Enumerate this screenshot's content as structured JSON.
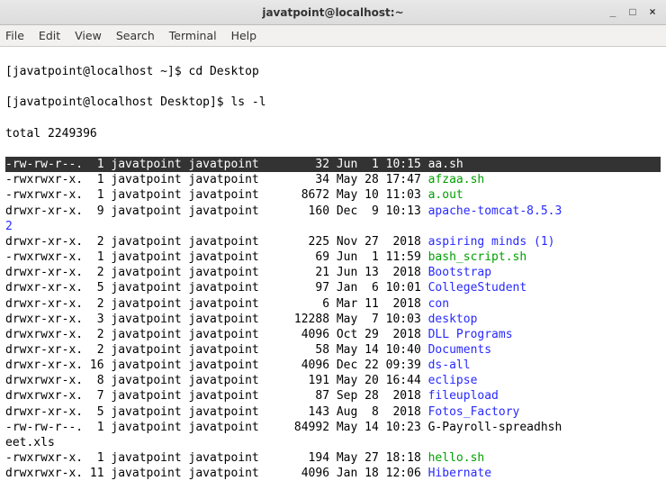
{
  "window": {
    "title": "javatpoint@localhost:~",
    "controls": {
      "min": "_",
      "max": "□",
      "close": "×"
    }
  },
  "menu": {
    "file": "File",
    "edit": "Edit",
    "view": "View",
    "search": "Search",
    "terminal": "Terminal",
    "help": "Help"
  },
  "prompt1": {
    "text": "[javatpoint@localhost ~]$ ",
    "cmd": "cd Desktop"
  },
  "prompt2": {
    "text": "[javatpoint@localhost Desktop]$ ",
    "cmd": "ls -l"
  },
  "total_line": "total 2249396",
  "rows": [
    {
      "perm": "-rw-rw-r--.",
      "links": " 1",
      "owner": "javatpoint",
      "group": "javatpoint",
      "size": "   32",
      "date": "Jun  1 10:15",
      "name": "aa.sh",
      "color": "hl",
      "wrap": ""
    },
    {
      "perm": "-rwxrwxr-x.",
      "links": " 1",
      "owner": "javatpoint",
      "group": "javatpoint",
      "size": "   34",
      "date": "May 28 17:47",
      "name": "afzaa.sh",
      "color": "green",
      "wrap": ""
    },
    {
      "perm": "-rwxrwxr-x.",
      "links": " 1",
      "owner": "javatpoint",
      "group": "javatpoint",
      "size": " 8672",
      "date": "May 10 11:03",
      "name": "a.out",
      "color": "green",
      "wrap": ""
    },
    {
      "perm": "drwxr-xr-x.",
      "links": " 9",
      "owner": "javatpoint",
      "group": "javatpoint",
      "size": "  160",
      "date": "Dec  9 10:13",
      "name": "apache-tomcat-8.5.3",
      "color": "blue",
      "wrap": "2"
    },
    {
      "perm": "drwxr-xr-x.",
      "links": " 2",
      "owner": "javatpoint",
      "group": "javatpoint",
      "size": "  225",
      "date": "Nov 27  2018",
      "name": "aspiring minds (1)",
      "color": "blue",
      "wrap": ""
    },
    {
      "perm": "-rwxrwxr-x.",
      "links": " 1",
      "owner": "javatpoint",
      "group": "javatpoint",
      "size": "   69",
      "date": "Jun  1 11:59",
      "name": "bash_script.sh",
      "color": "green",
      "wrap": ""
    },
    {
      "perm": "drwxr-xr-x.",
      "links": " 2",
      "owner": "javatpoint",
      "group": "javatpoint",
      "size": "   21",
      "date": "Jun 13  2018",
      "name": "Bootstrap",
      "color": "blue",
      "wrap": ""
    },
    {
      "perm": "drwxr-xr-x.",
      "links": " 5",
      "owner": "javatpoint",
      "group": "javatpoint",
      "size": "   97",
      "date": "Jan  6 10:01",
      "name": "CollegeStudent",
      "color": "blue",
      "wrap": ""
    },
    {
      "perm": "drwxr-xr-x.",
      "links": " 2",
      "owner": "javatpoint",
      "group": "javatpoint",
      "size": "    6",
      "date": "Mar 11  2018",
      "name": "con",
      "color": "blue",
      "wrap": ""
    },
    {
      "perm": "drwxr-xr-x.",
      "links": " 3",
      "owner": "javatpoint",
      "group": "javatpoint",
      "size": "12288",
      "date": "May  7 10:03",
      "name": "desktop",
      "color": "blue",
      "wrap": ""
    },
    {
      "perm": "drwxrwxr-x.",
      "links": " 2",
      "owner": "javatpoint",
      "group": "javatpoint",
      "size": " 4096",
      "date": "Oct 29  2018",
      "name": "DLL Programs",
      "color": "blue",
      "wrap": ""
    },
    {
      "perm": "drwxr-xr-x.",
      "links": " 2",
      "owner": "javatpoint",
      "group": "javatpoint",
      "size": "   58",
      "date": "May 14 10:40",
      "name": "Documents",
      "color": "blue",
      "wrap": ""
    },
    {
      "perm": "drwxr-xr-x.",
      "links": "16",
      "owner": "javatpoint",
      "group": "javatpoint",
      "size": " 4096",
      "date": "Dec 22 09:39",
      "name": "ds-all",
      "color": "blue",
      "wrap": ""
    },
    {
      "perm": "drwxrwxr-x.",
      "links": " 8",
      "owner": "javatpoint",
      "group": "javatpoint",
      "size": "  191",
      "date": "May 20 16:44",
      "name": "eclipse",
      "color": "blue",
      "wrap": ""
    },
    {
      "perm": "drwxrwxr-x.",
      "links": " 7",
      "owner": "javatpoint",
      "group": "javatpoint",
      "size": "   87",
      "date": "Sep 28  2018",
      "name": "fileupload",
      "color": "blue",
      "wrap": ""
    },
    {
      "perm": "drwxr-xr-x.",
      "links": " 5",
      "owner": "javatpoint",
      "group": "javatpoint",
      "size": "  143",
      "date": "Aug  8  2018",
      "name": "Fotos_Factory",
      "color": "blue",
      "wrap": ""
    },
    {
      "perm": "-rw-rw-r--.",
      "links": " 1",
      "owner": "javatpoint",
      "group": "javatpoint",
      "size": "84992",
      "date": "May 14 10:23",
      "name": "G-Payroll-spreadhsh",
      "color": "",
      "wrap": "eet.xls"
    },
    {
      "perm": "-rwxrwxr-x.",
      "links": " 1",
      "owner": "javatpoint",
      "group": "javatpoint",
      "size": "  194",
      "date": "May 27 18:18",
      "name": "hello.sh",
      "color": "green",
      "wrap": ""
    },
    {
      "perm": "drwxrwxr-x.",
      "links": "11",
      "owner": "javatpoint",
      "group": "javatpoint",
      "size": " 4096",
      "date": "Jan 18 12:06",
      "name": "Hibernate",
      "color": "blue",
      "wrap": ""
    }
  ]
}
